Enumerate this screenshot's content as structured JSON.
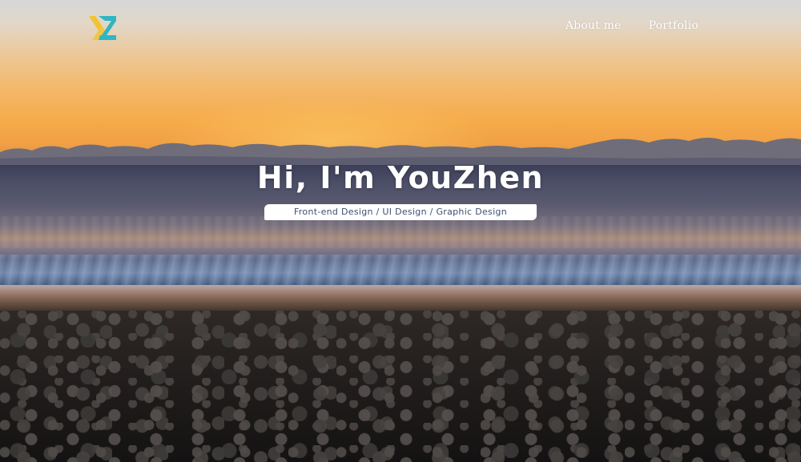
{
  "nav": {
    "logo_icon": "yz-monogram-logo",
    "links": [
      {
        "label": "About me"
      },
      {
        "label": "Portfolio"
      }
    ]
  },
  "hero": {
    "headline": "Hi, I'm YouZhen",
    "tagline": "Front-end Design / UI Design / Graphic Design",
    "background": "sunset-beach-photo"
  },
  "colors": {
    "logo_yellow": "#f2c230",
    "logo_teal": "#2fb6c2",
    "tagline_text": "#3d5070",
    "nav_text": "#ffffff"
  }
}
